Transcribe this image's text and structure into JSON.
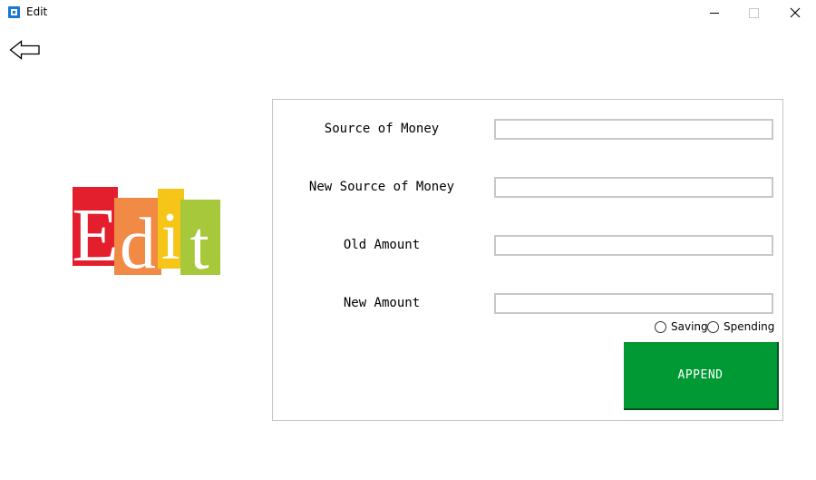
{
  "window": {
    "title": "Edit"
  },
  "logo": {
    "letters": [
      "E",
      "d",
      "i",
      "t"
    ],
    "colors": [
      "#e31e2d",
      "#f08a45",
      "#f5c518",
      "#a6c83a"
    ]
  },
  "form": {
    "source_label": "Source of Money",
    "source_value": "",
    "new_source_label": "New Source of Money",
    "new_source_value": "",
    "old_amount_label": "Old Amount",
    "old_amount_value": "",
    "new_amount_label": "New Amount",
    "new_amount_value": "",
    "radio_options": [
      "Saving",
      "Spending"
    ],
    "append_label": "APPEND",
    "append_color": "#009933"
  },
  "icons": {
    "back": "back-arrow-icon",
    "app": "app-icon",
    "minimize": "minimize-icon",
    "maximize": "maximize-icon",
    "close": "close-icon"
  }
}
